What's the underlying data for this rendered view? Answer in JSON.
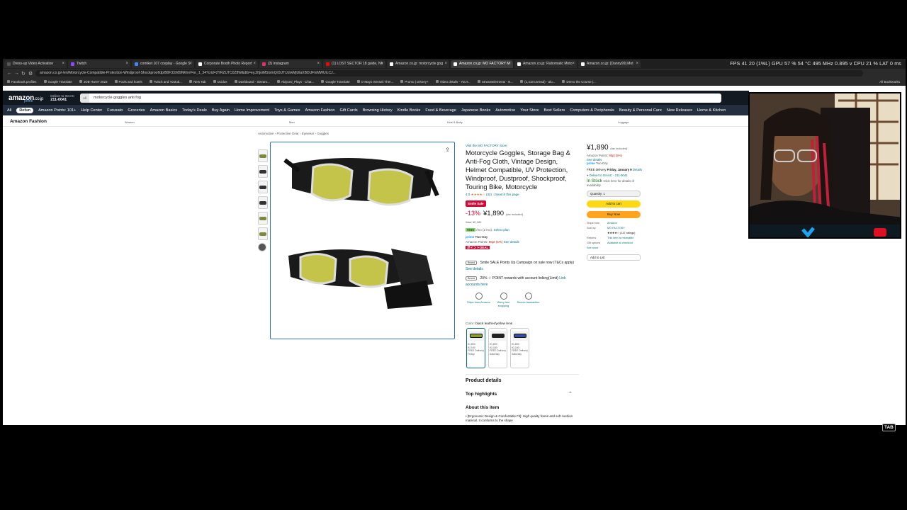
{
  "browser": {
    "tabs": [
      {
        "label": "Dress-up Video Activation",
        "color": "#555"
      },
      {
        "label": "Twitch",
        "color": "#9146ff"
      },
      {
        "label": "comiket 107 cosplay - Google S",
        "color": "#4285f4"
      },
      {
        "label": "Corporate Booth Photo Report",
        "color": "#fff"
      },
      {
        "label": "(3) Instagram",
        "color": "#e1306c"
      },
      {
        "label": "(1) LOST SECTOR 18 guide, Nir",
        "color": "#ff0000"
      },
      {
        "label": "Amazon.co.jp: motorcycle gog",
        "color": "#fff"
      },
      {
        "label": "Amazon.co.jp: MO FACTORY M",
        "color": "#fff"
      },
      {
        "label": "Amazon.co.jp: Rubomatic Moto",
        "color": "#fff"
      },
      {
        "label": "Amazon.co.jp: [Danny99] Mot",
        "color": "#fff"
      }
    ],
    "stats": "FPS   41   20 (1%L)    GPU   57 %  54 °C  495 MHz  0.895 v     CPU  21 %     LAT  0 ms",
    "url": "amazon.co.jp/-/en/Motorcycle-Compatible-Protection-Windproof-Shockproof/dp/B0F33X89NK/ref=sr_1_34?crid=2YRZUTC0Z8W&dib=eyJ2IjoiMSIsInQiOiJTUzIwMjUtaXBDUFIxMWUiLCJ...",
    "bookmarks": [
      "Facebook profiles",
      "Google Translate",
      "JOB HUNT 2023",
      "Pools and hotels",
      "Twitch and Youtub...",
      "New Tab",
      "Ocidos",
      "Dashboard - Stream...",
      "Akiyumi_Plays - Chat...",
      "Google Translate",
      "O Mayo Senseii Ther...",
      "Promo | Disney+",
      "Video details - YouT...",
      "StreamElements - N...",
      "(1,418 unread) - alu...",
      "Demo the Course |..."
    ],
    "all_bookmarks": "All Bookmarks"
  },
  "amazon": {
    "logo": "amazon",
    "logo_suffix": ".co.jp",
    "logo_sub": "prime",
    "deliver_to": "Deliver to ISAAC",
    "deliver_zip": "211-0041",
    "search_all": "All",
    "search_query": "motorcycle goggles anti fog",
    "nav": [
      "All",
      "Refun",
      "Amazon Points: 101+",
      "Help Center",
      "Furusato",
      "Groceries",
      "Amazon Basics",
      "Today's Deals",
      "Buy Again",
      "Home Improvement",
      "Toys & Games",
      "Amazon Fashion",
      "Gift Cards",
      "Browsing History",
      "Kindle Books",
      "Food & Beverage",
      "Japanese Books",
      "Automotive",
      "Your Store",
      "Best Sellers",
      "Computers & Peripherals",
      "Beauty & Personal Care",
      "New Releases",
      "Home & Kitchen"
    ],
    "fashion": "Amazon Fashion",
    "subnav": [
      "Women",
      "Men",
      "Kids & Baby",
      "Luggage"
    ],
    "breadcrumb": "Automotive › Protective Gear › Eyewear › Goggles"
  },
  "product": {
    "store": "Visit the MO FACTORY Store",
    "title": "Motorcycle Goggles, Storage Bag & Anti-Fog Cloth, Vintage Design, Helmet Compatible, UV Protection, Windproof, Dustproof, Shockproof, Touring Bike, Motorcycle",
    "rating": "4.0",
    "stars": "★★★★☆",
    "reviews": "(32)",
    "search_page": "Search this page",
    "smile_sale": "Smile Sale",
    "discount": "-13%",
    "price": "¥1,890",
    "tax_note": "(tax included)",
    "was_price": "Was: ¥2,180",
    "coupon_badge": "¥945",
    "coupon_text": "/mo (2 mo).",
    "coupon_link": "Select plan",
    "prime_label": "prime",
    "prime_text": "Two-Day",
    "points_label": "Amazon Points:",
    "points_value": "95pt",
    "points_pct": "(5%)",
    "points_link": "See details",
    "point_deal": "ポイントDEAL",
    "promo1_tag": "Brand",
    "promo1": "Smile SALE Points Up Campaign on sale now (T&Cs apply)",
    "promo1_link": "See details",
    "promo2_tag": "Brand",
    "promo2": "20% ☆ POINT rewards with account linking(Limit)",
    "promo2_link": "Link accounts here",
    "trust": [
      "Ships from Amazon",
      "Worry free shopping",
      "Secure transaction"
    ],
    "color_label": "Color:",
    "color_value": "black leather/yellow lens",
    "swatches": [
      {
        "price": "¥1,890",
        "was": "¥2,180",
        "delivery": "FREE Delivery",
        "day": "Friday"
      },
      {
        "price": "¥1,890",
        "was": "¥2,180",
        "delivery": "FREE Delivery",
        "day": "Saturday"
      },
      {
        "price": "¥1,890",
        "was": "¥2,180",
        "delivery": "FREE Delivery",
        "day": "Saturday"
      }
    ],
    "product_details": "Product details",
    "top_highlights": "Top highlights",
    "about": "About this item",
    "about_text": "• [Ergonomic Design & Comfortable Fit]: High quality frame and soft cushion material. It conforms to the shape"
  },
  "buybox": {
    "price": "¥1,890",
    "tax": "(tax included)",
    "points_label": "Amazon Points:",
    "points": "95pt (5%)",
    "see_details": "See details",
    "prime": "prime",
    "prime_text": "Two-Day",
    "free_delivery": "FREE delivery",
    "delivery_day": "Friday, January 9",
    "details_link": "Details",
    "deliver_to": "Deliver to ISAAC - 211-0041",
    "in_stock": "In Stock",
    "availability": "Click here for details of availability.",
    "quantity": "Quantity: 1",
    "add_to_cart": "Add to cart",
    "buy_now": "Buy Now",
    "ships_from_k": "Ships from",
    "ships_from_v": "Amazon",
    "sold_by_k": "Sold by",
    "sold_by_v": "MO FACTORY",
    "seller_stars": "★★★★☆ (147 ratings)",
    "returns_k": "Returns",
    "returns_v": "This item is returnable",
    "gift_k": "Gift options",
    "gift_v": "Available at checkout",
    "see_more": "See more",
    "add_to_list": "Add to List"
  },
  "overlay": {
    "tab_key": "TAB"
  }
}
